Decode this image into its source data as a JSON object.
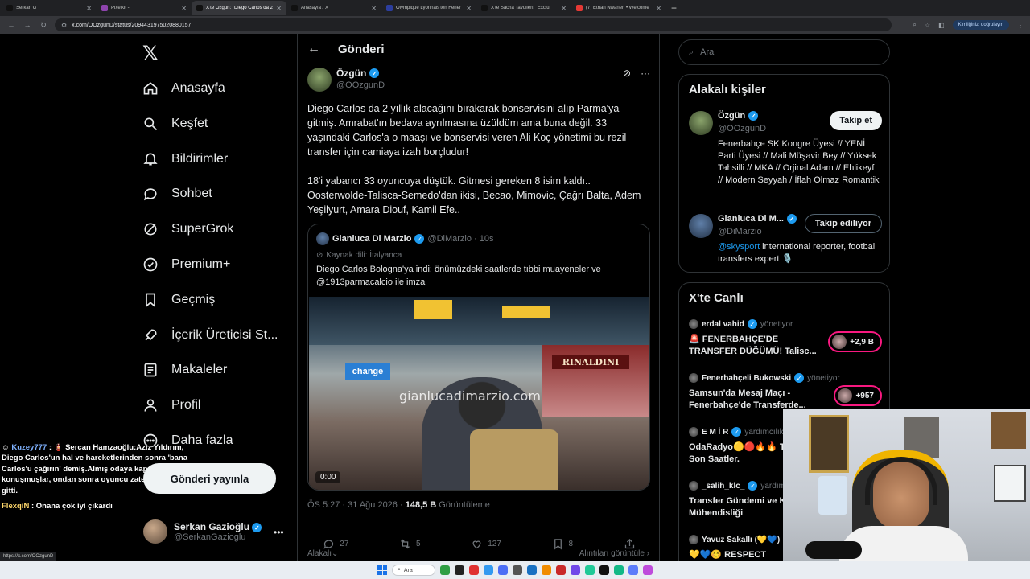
{
  "browser": {
    "tabs": [
      {
        "label": "Serkan G",
        "fav": "#111111",
        "active": false
      },
      {
        "label": "Pixelkit -",
        "fav": "#8e44ad",
        "active": false
      },
      {
        "label": "X'te Özgün: \"Diego Carlos da 2",
        "fav": "#111111",
        "active": true
      },
      {
        "label": "Anasayfa / X",
        "fav": "#111111",
        "active": false
      },
      {
        "label": "Olympique Lyonnais'ten Fener",
        "fav": "#2c3e9e",
        "active": false
      },
      {
        "label": "X'te Sacha Tavolieri: \"Exclu",
        "fav": "#111111",
        "active": false
      },
      {
        "label": "(7) Ethan Nwaneri • Welcome",
        "fav": "#e53935",
        "active": false
      }
    ],
    "url": "x.com/OOzgunD/status/2094431975020880157",
    "verify": "Kimliğinizi doğrulayın"
  },
  "nav": {
    "items": [
      {
        "label": "Anasayfa",
        "icon": "home-icon"
      },
      {
        "label": "Keşfet",
        "icon": "search-icon"
      },
      {
        "label": "Bildirimler",
        "icon": "bell-icon"
      },
      {
        "label": "Sohbet",
        "icon": "chat-icon"
      },
      {
        "label": "SuperGrok",
        "icon": "grok-icon"
      },
      {
        "label": "Premium+",
        "icon": "verified-icon"
      },
      {
        "label": "Geçmiş",
        "icon": "bookmark-icon"
      },
      {
        "label": "İçerik Üreticisi St...",
        "icon": "rocket-icon"
      },
      {
        "label": "Makaleler",
        "icon": "article-icon"
      },
      {
        "label": "Profil",
        "icon": "profile-icon"
      },
      {
        "label": "Daha fazla",
        "icon": "more-icon"
      }
    ],
    "post_button": "Gönderi yayınla",
    "account": {
      "name": "Serkan Gazioğlu",
      "handle": "@SerkanGazioglu"
    }
  },
  "chat": [
    {
      "user": "Kuzey777",
      "text": " : 🧯 Sercan Hamzaoğlu:Aziz Yıldırım, Diego Carlos'un hal ve hareketlerinden sonra 'bana Carlos'u çağırın' demiş.Almış odaya kapıyı kapatmış, konuşmuşlar, ondan sonra oyuncu zaten Parma'ya gitti."
    },
    {
      "user": "FlexqiN",
      "text": " : Onana çok iyi çıkardı"
    }
  ],
  "post": {
    "header": "Gönderi",
    "author": "Özgün",
    "handle": "@OOzgunD",
    "paragraphs": [
      "Diego Carlos da 2 yıllık alacağını bırakarak bonservisini alıp Parma'ya gitmiş. Amrabat'ın bedava ayrılmasına üzüldüm ama buna değil. 33 yaşındaki Carlos'a o maaşı ve bonservisi veren Ali Koç yönetimi bu rezil transfer için camiaya izah borçludur!",
      "18'i yabancı 33 oyuncuya düştük. Gitmesi gereken 8 isim kaldı.. Oosterwolde-Talisca-Semedo'dan ikisi, Becao, Mimovic, Çağrı Balta, Adem Yeşilyurt, Amara Diouf, Kamil Efe.."
    ],
    "quote": {
      "author": "Gianluca Di Marzio",
      "handle": "@DiMarzio · 10s",
      "source": "Kaynak dili: İtalyanca",
      "text": "Diego Carlos Bologna'ya indi: önümüzdeki saatlerde tıbbi muayeneler ve @1913parmacalcio ile imza",
      "watermark": "gianlucadimarzio.com",
      "video_time": "0:00",
      "sign_change": "change",
      "sign_shop": "RINALDINI"
    },
    "time": "ÖS 5:27 · 31 Ağu 2026 · ",
    "views": "148,5 B",
    "views_label": " Görüntüleme",
    "stats": {
      "replies": "27",
      "reposts": "5",
      "likes": "127",
      "bookmarks": "8"
    },
    "reply_filter": "Alakalı",
    "see_quotes": "Alıntıları görüntüle"
  },
  "right": {
    "search_placeholder": "Ara",
    "related_title": "Alakalı kişiler",
    "people": [
      {
        "name": "Özgün",
        "handle": "@OOzgunD",
        "bio": "Fenerbahçe SK Kongre Üyesi // YENİ Parti Üyesi // Mali Müşavir Bey // Yüksek Tahsilli // MKA // Orjinal Adam // Ehlikeyf // Modern Seyyah / İflah Olmaz Romantik",
        "bio_link": "",
        "button": "Takip et",
        "following": false
      },
      {
        "name": "Gianluca Di M...",
        "handle": "@DiMarzio",
        "bio": " international reporter, football transfers expert 🎙️",
        "bio_link": "@skysport",
        "button": "Takip ediliyor",
        "following": true
      }
    ],
    "live_title": "X'te Canlı",
    "live": [
      {
        "host": "erdal vahid",
        "role": "yönetiyor",
        "title": "🚨 FENERBAHÇE'DE TRANSFER DÜĞÜMÜ! Talisc...",
        "count": "+2,9 B"
      },
      {
        "host": "Fenerbahçeli Bukowski",
        "role": "yönetiyor",
        "title": "Samsun'da Mesaj Maçı - Fenerbahçe'de Transferde...",
        "count": "+957"
      },
      {
        "host": "E M İ R",
        "role": "yardımcılık yap",
        "title": "OdaRadyo🟡🔴🔥🔥 Transfer Son Saatler.",
        "count": ""
      },
      {
        "host": "_salih_klc_",
        "role": "yardımc",
        "title": "Transfer Gündemi ve Kadro Mühendisliği",
        "count": ""
      },
      {
        "host": "Yavuz Sakallı (💛💙)",
        "role": "",
        "title": "💛💙😊 RESPECT",
        "count": ""
      }
    ]
  },
  "status_url": "https://x.com/OOzgunD",
  "taskbar": {
    "search": "Ara"
  }
}
